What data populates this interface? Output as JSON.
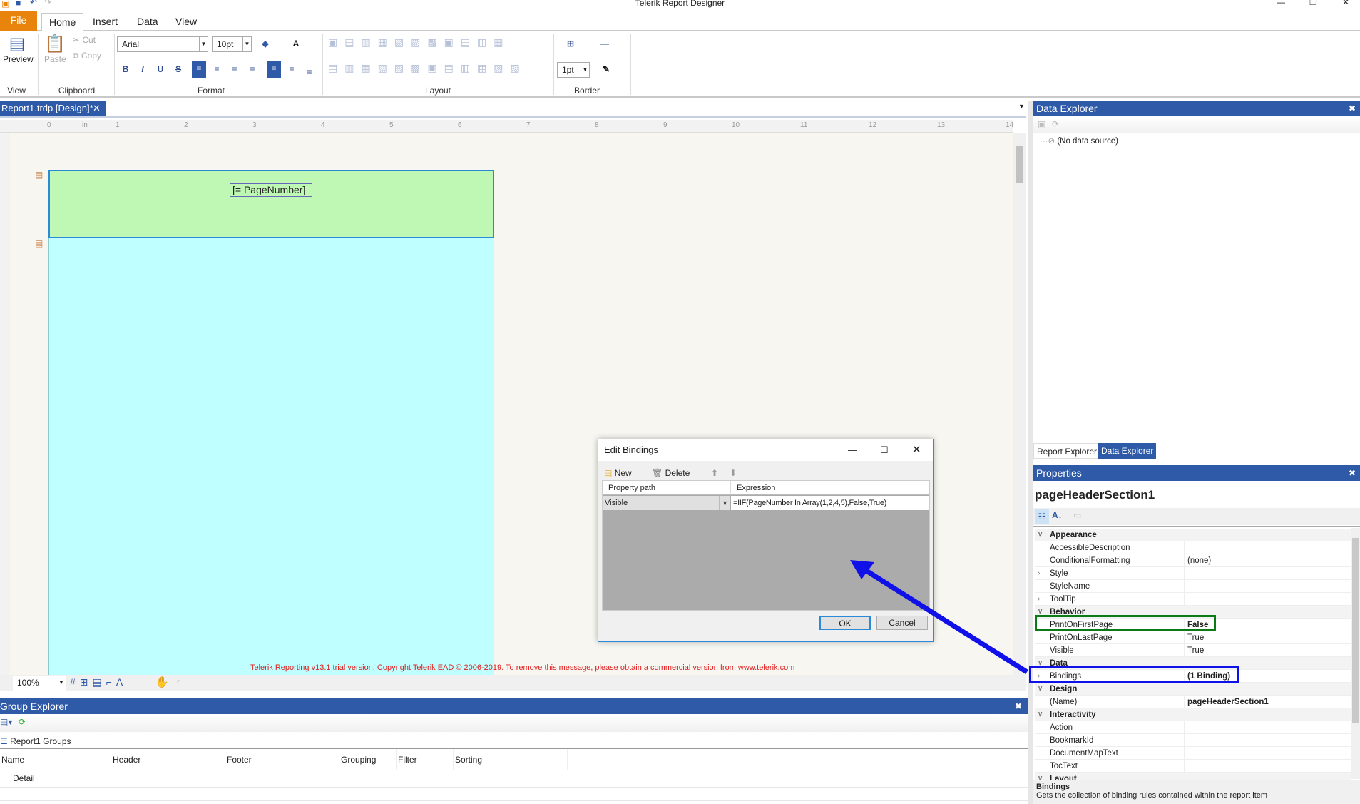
{
  "window": {
    "title": "Telerik Report Designer"
  },
  "ribbon": {
    "tabs": [
      "File",
      "Home",
      "Insert",
      "Data",
      "View"
    ],
    "preview": "Preview",
    "paste": "Paste",
    "cut": "Cut",
    "copy": "Copy",
    "font": "Arial",
    "font_size": "10pt",
    "border_width": "1pt",
    "groups": [
      "View",
      "Clipboard",
      "Format",
      "Layout",
      "Border"
    ]
  },
  "document": {
    "tab": "Report1.trdp [Design]*",
    "textbox": "[= PageNumber]",
    "ruler": [
      "0",
      "in",
      "1",
      "2",
      "3",
      "4",
      "5",
      "6",
      "7",
      "8",
      "9",
      "10",
      "11",
      "12",
      "13",
      "14"
    ],
    "watermark": "Telerik Reporting v13.1 trial version. Copyright Telerik EAD © 2006-2019. To remove this message, please obtain a commercial version from www.telerik.com",
    "zoom": "100%",
    "header_color": "#bff7b4",
    "detail_color": "#bfffff"
  },
  "group_explorer": {
    "title": "Group Explorer",
    "root": "Report1 Groups",
    "columns": [
      "Name",
      "Header",
      "Footer",
      "Grouping",
      "Filter",
      "Sorting"
    ],
    "rows": [
      [
        "Detail",
        "",
        "",
        "",
        "",
        ""
      ]
    ]
  },
  "data_explorer": {
    "title": "Data Explorer",
    "item": "(No data source)"
  },
  "explorer_tabs": [
    "Report Explorer",
    "Data Explorer"
  ],
  "properties": {
    "title": "Properties",
    "object": "pageHeaderSection1",
    "rows": [
      {
        "type": "cat",
        "name": "Appearance"
      },
      {
        "name": "AccessibleDescription",
        "value": ""
      },
      {
        "name": "ConditionalFormatting",
        "value": "(none)"
      },
      {
        "name": "Style",
        "value": "",
        "expand": true
      },
      {
        "name": "StyleName",
        "value": ""
      },
      {
        "name": "ToolTip",
        "value": "",
        "expand": true
      },
      {
        "type": "cat",
        "name": "Behavior"
      },
      {
        "name": "PrintOnFirstPage",
        "value": "False",
        "bold": true
      },
      {
        "name": "PrintOnLastPage",
        "value": "True"
      },
      {
        "name": "Visible",
        "value": "True"
      },
      {
        "type": "cat",
        "name": "Data"
      },
      {
        "name": "Bindings",
        "value": "(1 Binding)",
        "bold": true,
        "expand": true
      },
      {
        "type": "cat",
        "name": "Design"
      },
      {
        "name": "(Name)",
        "value": "pageHeaderSection1",
        "bold": true
      },
      {
        "type": "cat",
        "name": "Interactivity"
      },
      {
        "name": "Action",
        "value": ""
      },
      {
        "name": "BookmarkId",
        "value": ""
      },
      {
        "name": "DocumentMapText",
        "value": ""
      },
      {
        "name": "TocText",
        "value": ""
      },
      {
        "type": "cat",
        "name": "Layout"
      }
    ],
    "desc_title": "Bindings",
    "desc_text": "Gets the collection of binding rules contained within the report item"
  },
  "dialog": {
    "title": "Edit Bindings",
    "new": "New",
    "delete": "Delete",
    "columns": [
      "Property path",
      "Expression"
    ],
    "property_path": "Visible",
    "expression": "=IIF(PageNumber In Array(1,2,4,5),False,True)",
    "ok": "OK",
    "cancel": "Cancel"
  },
  "annotations": {
    "green_box": "#0b7a16",
    "blue_box": "#1010e8",
    "arrow": "#1010e8"
  }
}
